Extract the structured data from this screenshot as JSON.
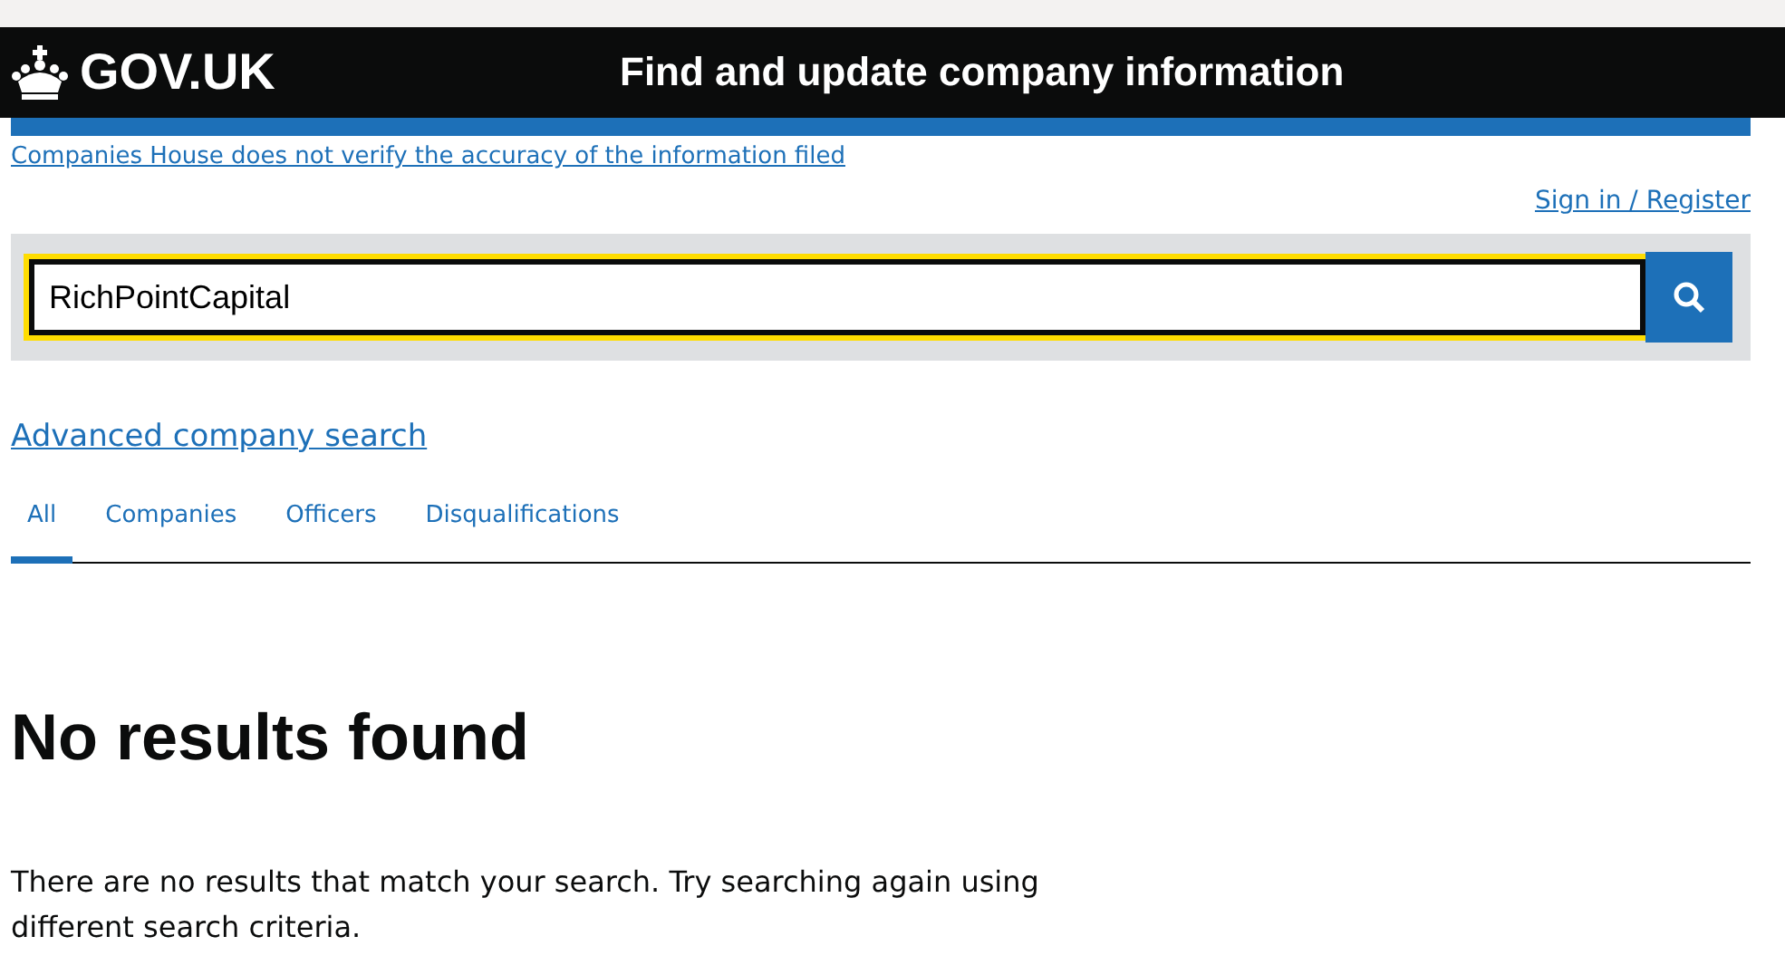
{
  "header": {
    "logo": "GOV.UK",
    "service_name": "Find and update company information"
  },
  "notice_link": "Companies House does not verify the accuracy of the information filed",
  "sign_in_link": "Sign in / Register",
  "search": {
    "value": "RichPointCapital"
  },
  "advanced_link": "Advanced company search",
  "tabs": [
    {
      "label": "All",
      "selected": true
    },
    {
      "label": "Companies",
      "selected": false
    },
    {
      "label": "Officers",
      "selected": false
    },
    {
      "label": "Disqualifications",
      "selected": false
    }
  ],
  "results": {
    "heading": "No results found",
    "message": "There are no results that match your search. Try searching again using different search criteria."
  }
}
